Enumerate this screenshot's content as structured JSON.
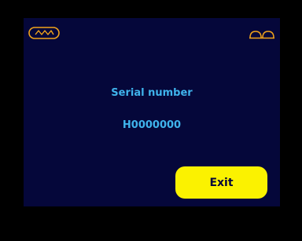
{
  "icons": {
    "wave_icon": "wave-icon",
    "glasses_icon": "glasses-icon",
    "icon_color": "#f2a41b"
  },
  "info": {
    "label": "Serial number",
    "value": "H0000000",
    "text_color": "#3fb3ec"
  },
  "exit_button": {
    "label": "Exit",
    "color": "#fbf200"
  },
  "colors": {
    "screen_background": "#05073a",
    "frame_background": "#000000"
  }
}
